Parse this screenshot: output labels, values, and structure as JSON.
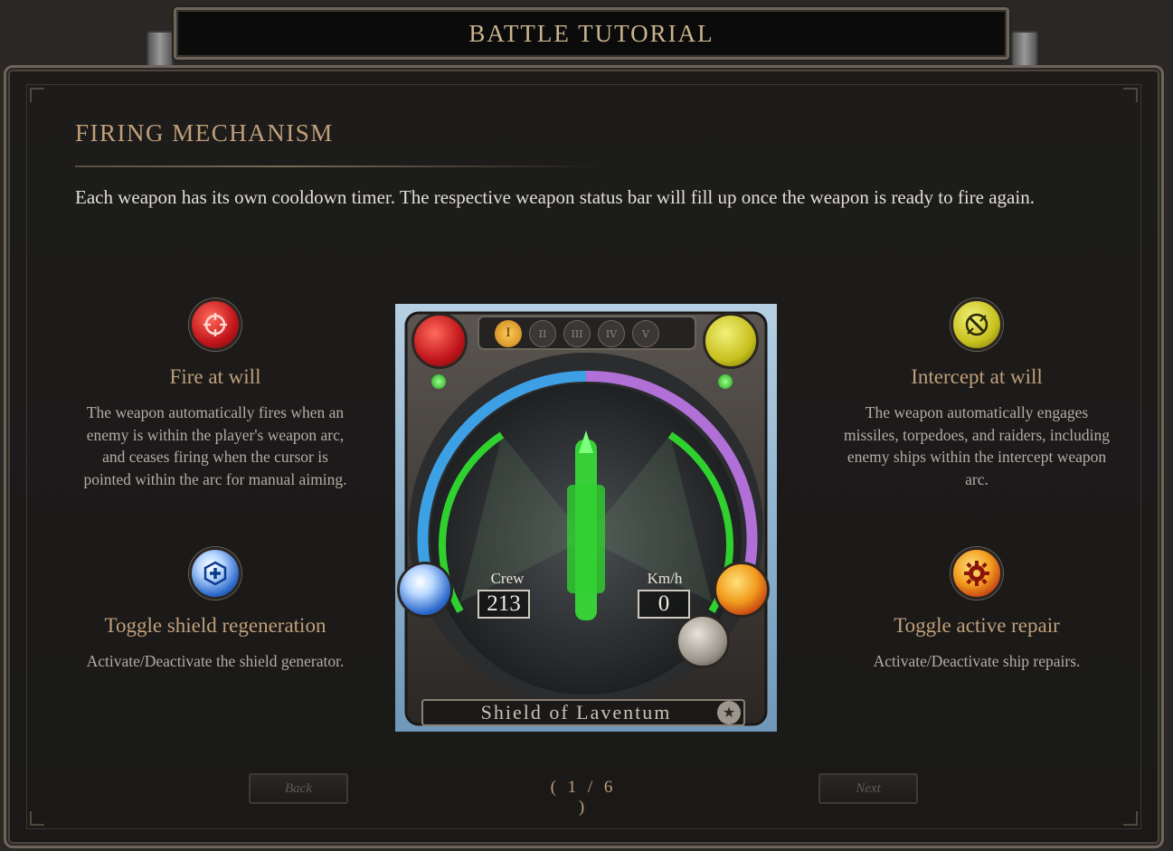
{
  "window": {
    "title": "BATTLE TUTORIAL"
  },
  "section": {
    "title": "FIRING MECHANISM",
    "description": "Each weapon has its own cooldown timer. The respective weapon status bar will fill up once the weapon is ready to fire again."
  },
  "features": {
    "fire_at_will": {
      "icon": "crosshair-icon",
      "title": "Fire at will",
      "text": "The weapon automatically fires when an enemy is within the player's weapon arc, and ceases firing when the cursor is pointed within the arc for manual aiming."
    },
    "intercept_at_will": {
      "icon": "intercept-icon",
      "title": "Intercept at will",
      "text": "The weapon automatically engages missiles, torpedoes, and raiders, including enemy ships within the intercept weapon arc."
    },
    "toggle_shield": {
      "icon": "shield-plus-icon",
      "title": "Toggle shield regeneration",
      "text": "Activate/Deactivate the shield generator."
    },
    "toggle_repair": {
      "icon": "gear-repair-icon",
      "title": "Toggle active repair",
      "text": "Activate/Deactivate ship repairs."
    }
  },
  "ship_panel": {
    "tabs": [
      "I",
      "II",
      "III",
      "IV",
      "V"
    ],
    "selected_tab": "I",
    "crew_label": "Crew",
    "crew_value": "213",
    "speed_label": "Km/h",
    "speed_value": "0",
    "ship_name": "Shield of Laventum"
  },
  "navigation": {
    "back_label": "Back",
    "next_label": "Next",
    "page_indicator": "( 1 / 6 )"
  },
  "colors": {
    "accent_gold": "#c19f7a",
    "fire_red": "#c0151b",
    "intercept_yellow": "#c7c01d",
    "shield_blue": "#2a67c9",
    "repair_orange": "#f29d1f",
    "arc_green": "#2fd12f",
    "ring_blue": "#3ea0e4",
    "ring_purple": "#b070d8"
  }
}
